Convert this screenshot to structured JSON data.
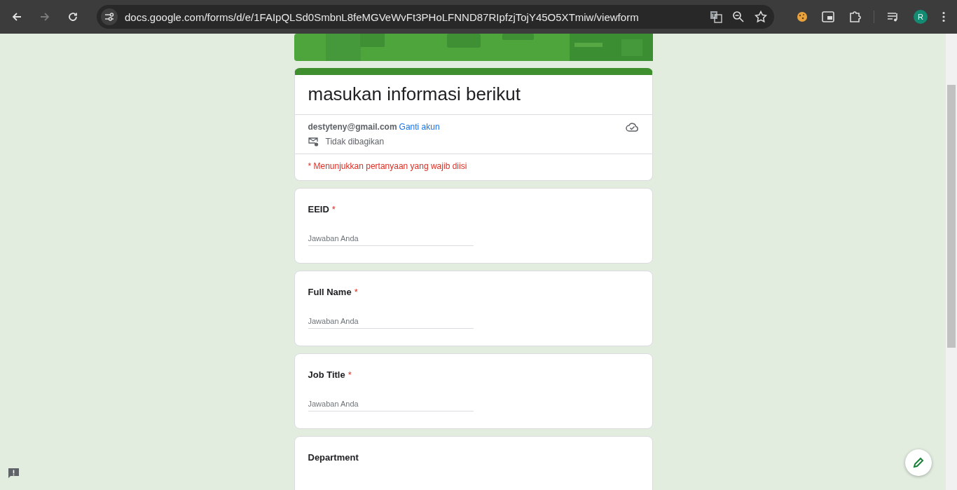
{
  "browser": {
    "url": "docs.google.com/forms/d/e/1FAIpQLSd0SmbnL8feMGVeWvFt3PHoLFNND87RIpfzjTojY45O5XTmiw/viewform",
    "back_disabled": false,
    "forward_disabled": true,
    "bookmarked": false,
    "avatar": "R"
  },
  "form": {
    "title": "masukan informasi berikut",
    "email": "destyteny@gmail.com",
    "switch_account": "Ganti akun",
    "sharing": "Tidak dibagikan",
    "required_note": "* Menunjukkan pertanyaan yang wajib diisi"
  },
  "questions": [
    {
      "label": "EEID",
      "mark": "*",
      "placeholder": "Jawaban Anda"
    },
    {
      "label": "Full Name",
      "mark": "*",
      "placeholder": "Jawaban Anda"
    },
    {
      "label": "Job Title",
      "mark": "*",
      "placeholder": "Jawaban Anda"
    },
    {
      "label": "Department"
    }
  ]
}
